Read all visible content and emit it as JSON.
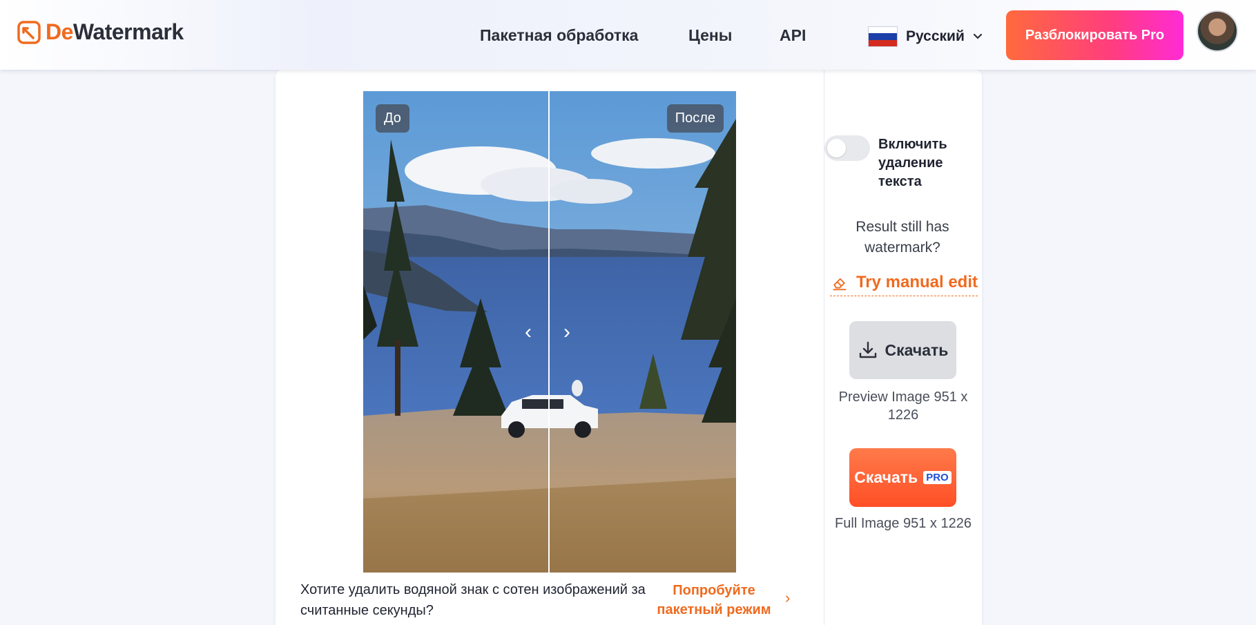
{
  "header": {
    "logo": {
      "de": "De",
      "rest": "Watermark"
    },
    "nav": {
      "batch": "Пакетная обработка",
      "prices": "Цены",
      "api": "API"
    },
    "language": {
      "label": "Русский"
    },
    "unlock_pro": "Разблокировать Pro"
  },
  "compare": {
    "before_label": "До",
    "after_label": "После"
  },
  "batch_promo": {
    "text": "Хотите удалить водяной знак с сотен изображений за считанные секунды?",
    "link": "Попробуйте пакетный режим"
  },
  "panel": {
    "toggle_label": "Включить удаление текста",
    "toggle_on": false,
    "still_watermark": "Result still has watermark?",
    "manual_edit": "Try manual edit",
    "download_preview": "Скачать",
    "preview_info": "Preview Image 951 x 1226",
    "download_full": "Скачать",
    "pro_badge": "PRO",
    "full_info": "Full Image 951 x 1226"
  },
  "colors": {
    "accent": "#f06a1e",
    "pro_gradient_start": "#ff6a3d",
    "pro_gradient_end": "#ff2bd6"
  }
}
